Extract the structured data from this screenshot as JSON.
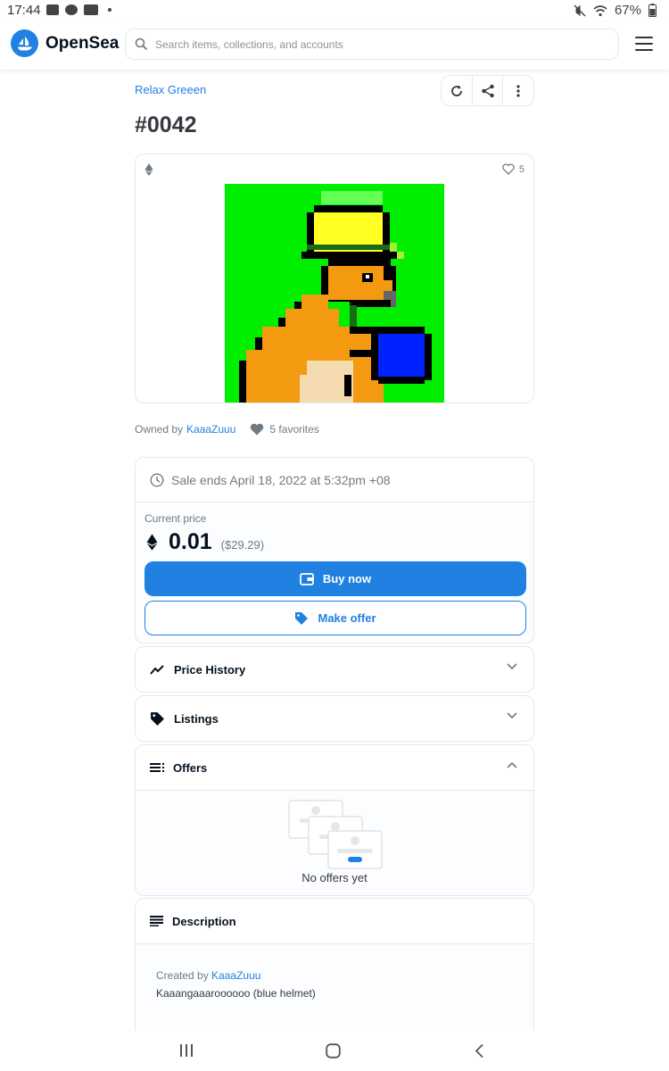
{
  "status_bar": {
    "time": "17:44",
    "battery": "67%",
    "icons": [
      "image-icon",
      "bug-icon",
      "youtube-icon",
      "mute-icon",
      "wifi-icon",
      "battery-icon"
    ]
  },
  "header": {
    "brand": "OpenSea",
    "search_placeholder": "Search items, collections, and accounts",
    "brand_color": "#2081e2"
  },
  "item": {
    "collection": "Relax Greeen",
    "title": "#0042",
    "favorites_count": "5",
    "owned_by_label": "Owned by",
    "owner": "KaaaZuuu",
    "favorites_label": "5 favorites"
  },
  "sale": {
    "ends": "Sale ends April 18, 2022 at 5:32pm +08",
    "current_price_label": "Current price",
    "price": "0.01",
    "price_usd": "($29.29)",
    "buy_label": "Buy now",
    "offer_label": "Make offer"
  },
  "panels": {
    "price_history": "Price History",
    "listings": "Listings",
    "offers": "Offers",
    "no_offers": "No offers yet",
    "description": "Description",
    "created_by_label": "Created by",
    "creator": "KaaaZuuu",
    "description_text": "Kaaangaaaroooooo (blue helmet)"
  }
}
